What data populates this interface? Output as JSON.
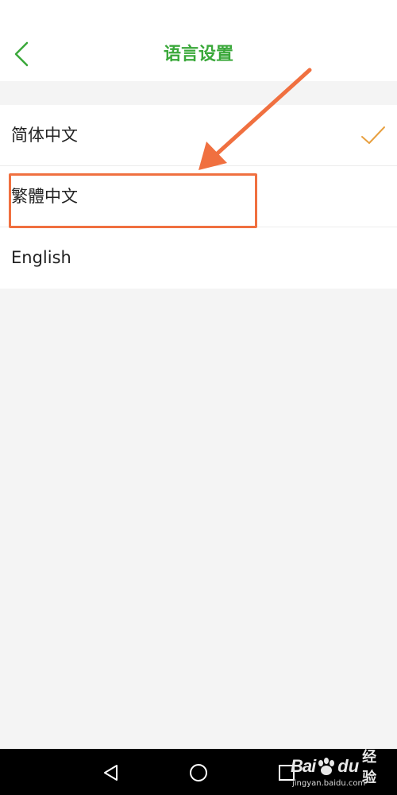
{
  "header": {
    "title": "语言设置",
    "back_icon": "chevron-left-icon"
  },
  "languages": [
    {
      "label": "简体中文",
      "selected": true
    },
    {
      "label": "繁體中文",
      "selected": false
    },
    {
      "label": "English",
      "selected": false
    }
  ],
  "annotation": {
    "target": "繁體中文",
    "color": "#f07040"
  },
  "nav_bar": {
    "back": "triangle-back-icon",
    "home": "circle-home-icon",
    "recents": "square-recents-icon"
  },
  "watermark": {
    "logo_left": "Bai",
    "logo_right": "du",
    "text": "经验",
    "url": "jingyan.baidu.com"
  },
  "colors": {
    "accent": "#3aa83a",
    "check": "#e8a040",
    "annotation": "#f07040",
    "background": "#f4f4f4"
  }
}
